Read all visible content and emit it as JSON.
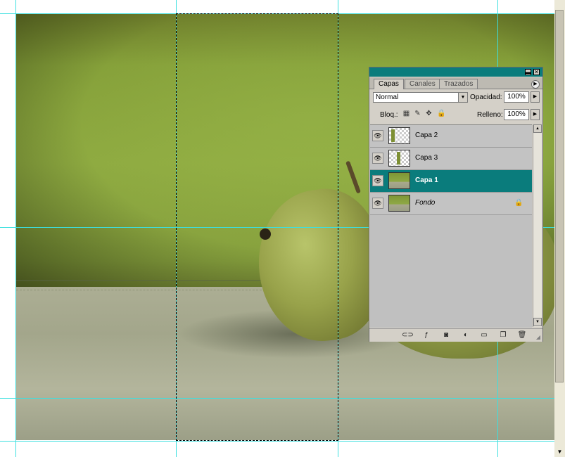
{
  "palette": {
    "tabs": [
      {
        "label": "Capas",
        "active": true
      },
      {
        "label": "Canales",
        "active": false
      },
      {
        "label": "Trazados",
        "active": false
      }
    ],
    "blend_mode": "Normal",
    "opacity_label": "Opacidad:",
    "opacity_value": "100%",
    "lock_label": "Bloq.:",
    "fill_label": "Relleno:",
    "fill_value": "100%",
    "layers": [
      {
        "name": "Capa 2",
        "visible": true,
        "selected": false
      },
      {
        "name": "Capa 3",
        "visible": true,
        "selected": false
      },
      {
        "name": "Capa 1",
        "visible": true,
        "selected": true
      },
      {
        "name": "Fondo",
        "visible": true,
        "selected": false,
        "locked": true
      }
    ]
  },
  "icons": {
    "eye": "eye-icon",
    "lock": "lock-icon",
    "palette_menu": "palette-menu-icon",
    "minimize": "minimize-icon",
    "close": "close-icon"
  },
  "colors": {
    "selection_highlight": "#0a7c7c",
    "guide": "#3ce0e0",
    "panel_bg": "#d4d0c8"
  }
}
